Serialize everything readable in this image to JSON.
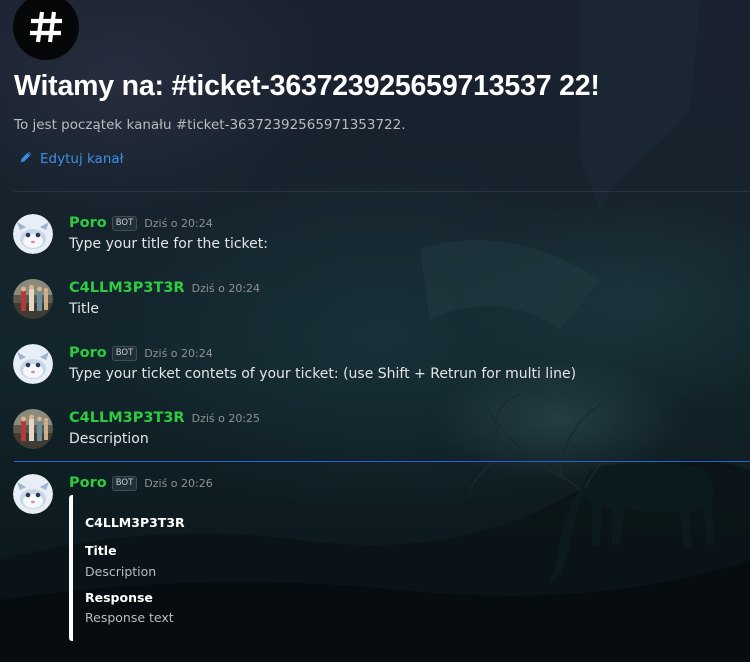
{
  "channel": {
    "icon": "hashtag-icon",
    "welcome_title": "Witamy na: #ticket-363723925659713537 22!",
    "welcome_subtitle": "To jest początek kanału #ticket-36372392565971353722.",
    "edit_label": "Edytuj kanał",
    "edit_icon": "pencil-icon"
  },
  "messages": [
    {
      "author": "Poro",
      "bot_tag": "BOT",
      "timestamp": "Dziś o 20:24",
      "text": "Type your title for the ticket:",
      "avatar_icon": "poro-avatar"
    },
    {
      "author": "C4LLM3P3T3R",
      "timestamp": "Dziś o 20:24",
      "text": "Title",
      "avatar_icon": "user-avatar"
    },
    {
      "author": "Poro",
      "bot_tag": "BOT",
      "timestamp": "Dziś o 20:24",
      "text": "Type your ticket contets of your ticket: (use Shift + Retrun for multi line)",
      "avatar_icon": "poro-avatar"
    },
    {
      "author": "C4LLM3P3T3R",
      "timestamp": "Dziś o 20:25",
      "text": "Description",
      "avatar_icon": "user-avatar"
    },
    {
      "author": "Poro",
      "bot_tag": "BOT",
      "timestamp": "Dziś o 20:26",
      "avatar_icon": "poro-avatar",
      "embed": {
        "author": "C4LLM3P3T3R",
        "fields": [
          {
            "name": "Title",
            "value": "Description"
          },
          {
            "name": "Response",
            "value": "Response text"
          }
        ]
      }
    }
  ],
  "colors": {
    "username": "#2ecc40",
    "link": "#3d8ee8",
    "new_messages_divider": "#2f5fd6",
    "embed_border": "#ffffff"
  }
}
